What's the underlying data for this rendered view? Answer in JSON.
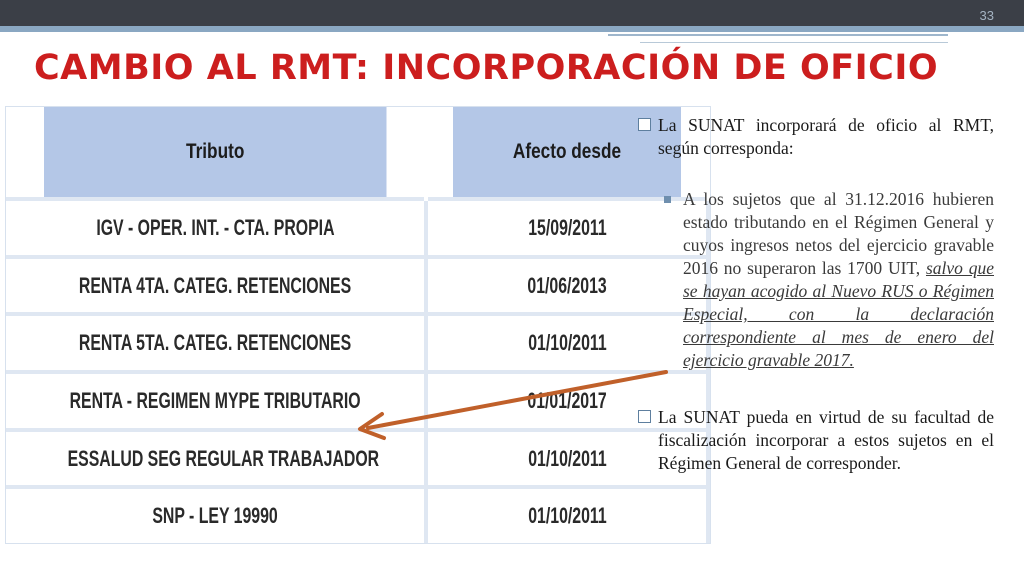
{
  "slide": {
    "number": "33",
    "title": "CAMBIO AL RMT: INCORPORACIÓN DE OFICIO"
  },
  "table": {
    "headers": [
      "Tributo",
      "Afecto desde"
    ],
    "rows": [
      {
        "tributo": "IGV - OPER. INT. - CTA. PROPIA",
        "fecha": "15/09/2011"
      },
      {
        "tributo": "RENTA 4TA. CATEG. RETENCIONES",
        "fecha": "01/06/2013"
      },
      {
        "tributo": "RENTA 5TA. CATEG. RETENCIONES",
        "fecha": "01/10/2011"
      },
      {
        "tributo": "RENTA - REGIMEN MYPE TRIBUTARIO",
        "fecha": "01/01/2017"
      },
      {
        "tributo": "ESSALUD SEG REGULAR TRABAJADOR",
        "fecha": "01/10/2011"
      },
      {
        "tributo": "SNP - LEY 19990",
        "fecha": "01/10/2011"
      }
    ]
  },
  "content": {
    "bullet1": "La SUNAT incorporará de oficio al RMT, según corresponda:",
    "sub_bullet_plain": "A los sujetos que al 31.12.2016 hubieren estado tributando en el Régimen General y cuyos ingresos netos del ejercicio gravable 2016 no superaron las 1700 UIT, ",
    "sub_bullet_emphasis": "salvo que se hayan acogido al Nuevo RUS o Régimen Especial, con la declaración correspondiente al mes de enero del ejercicio gravable 2017.",
    "bullet2": "La SUNAT pueda en virtud de su facultad de fiscalización incorporar a estos sujetos en el Régimen General de corresponder."
  },
  "colors": {
    "title": "#cc1e1e",
    "table_header": "#b4c7e7",
    "arrow": "#c0602a",
    "topbar": "#3b3f47"
  },
  "icons": {
    "bullet_level1": "checkbox-icon",
    "bullet_level2": "square-bullet-icon",
    "annotation": "arrow-icon"
  }
}
